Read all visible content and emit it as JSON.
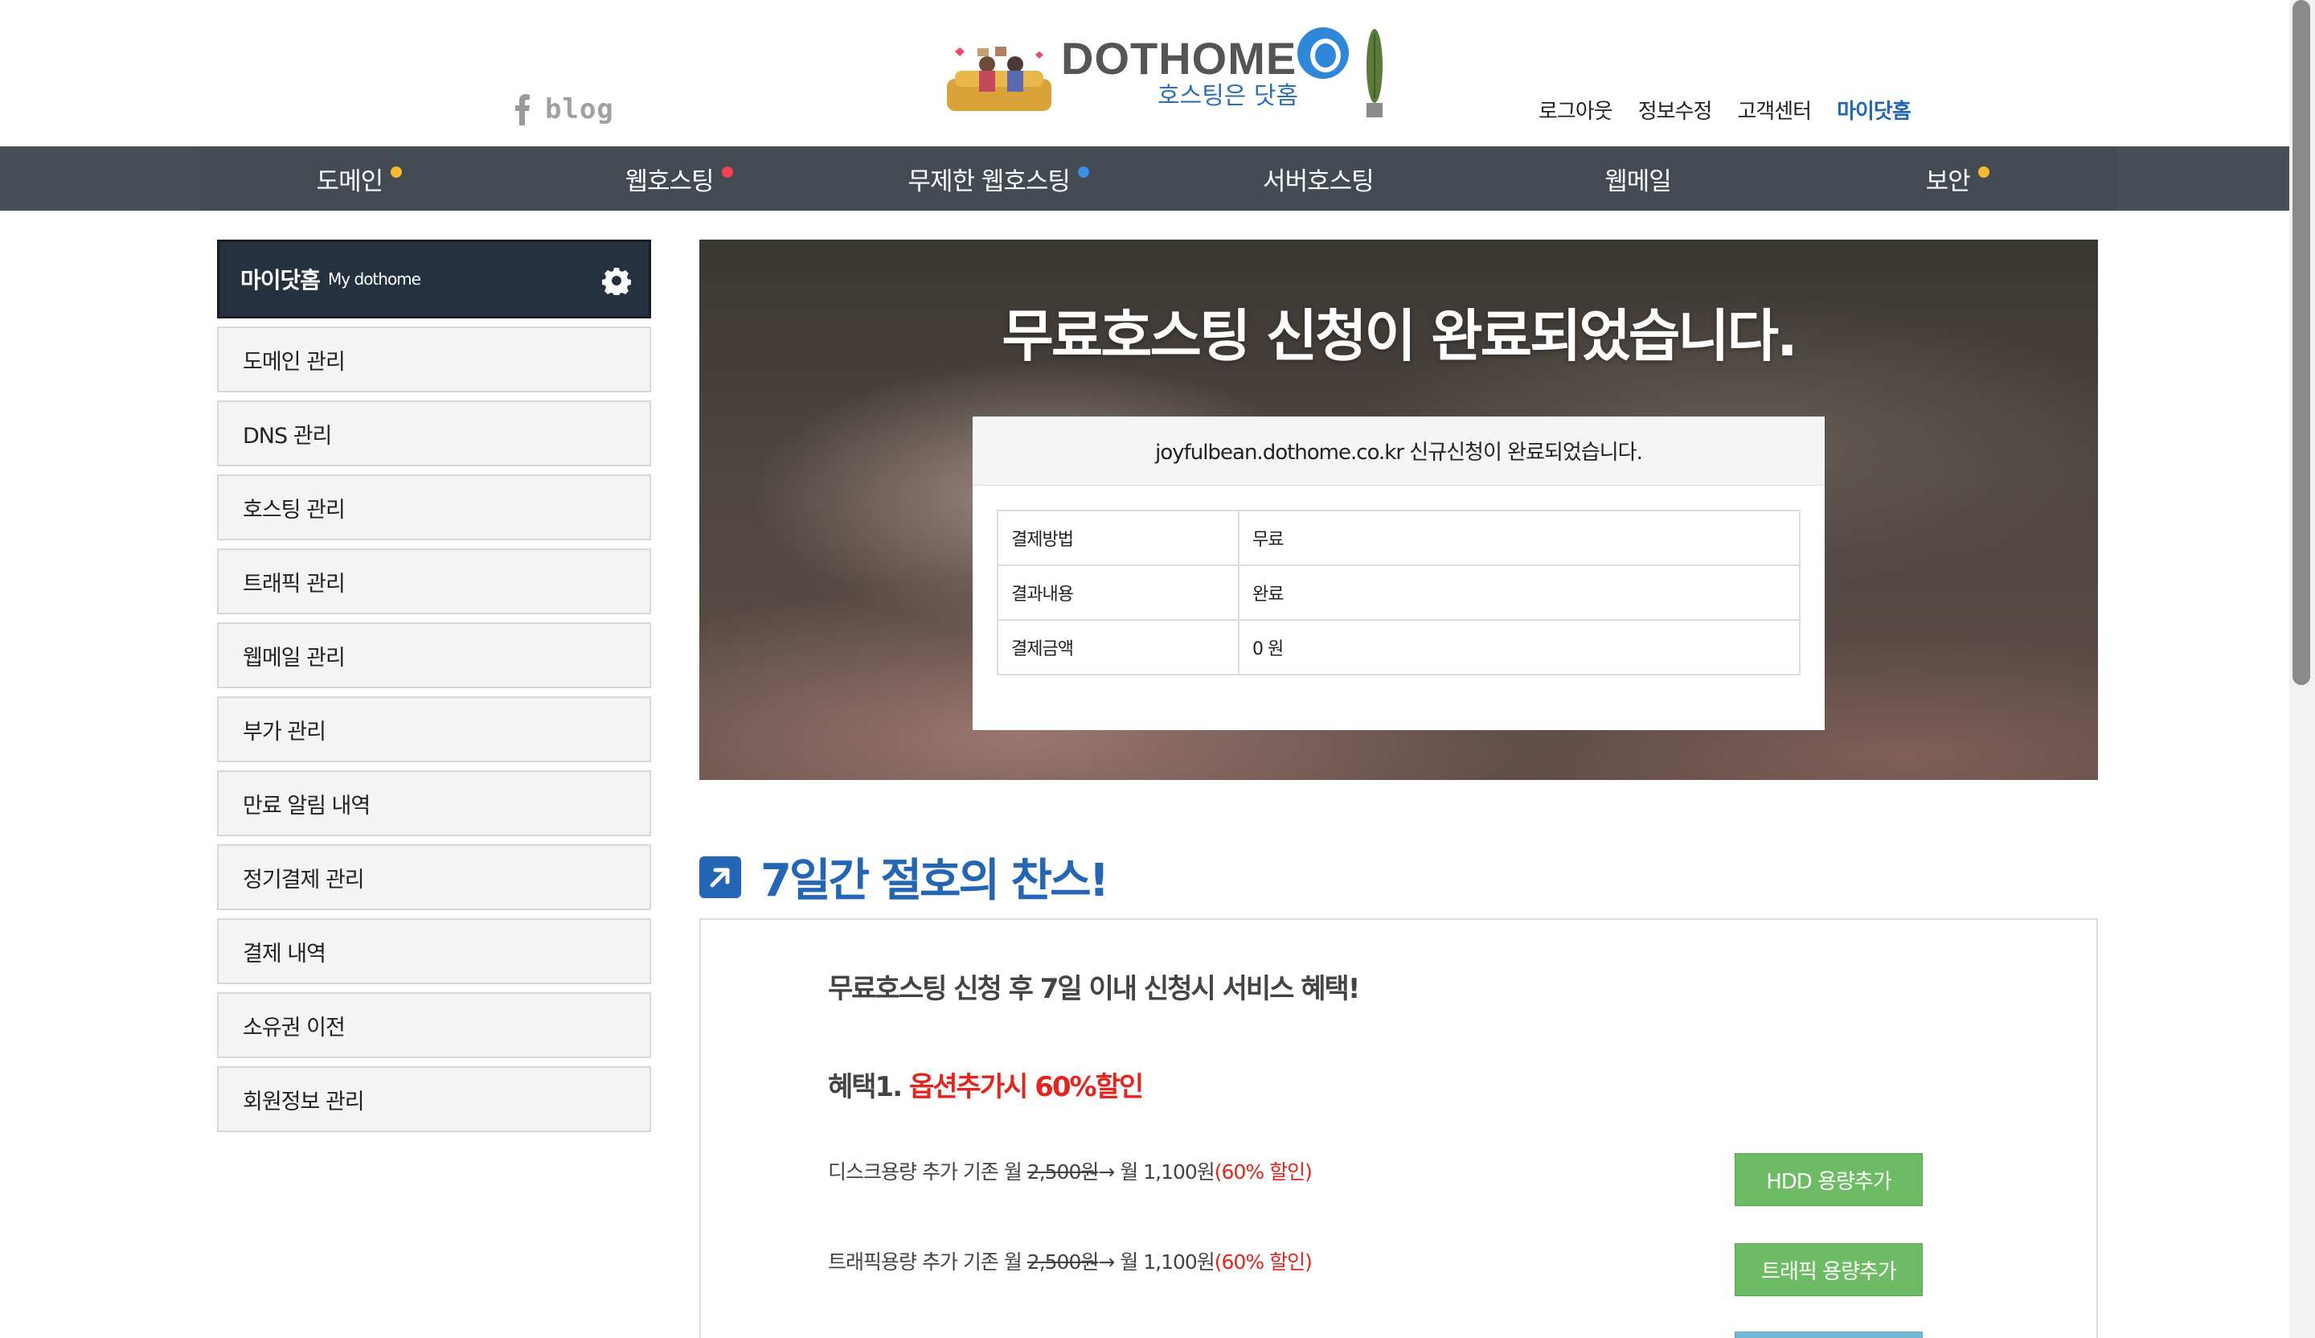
{
  "header": {
    "blog_label": "blog",
    "logo_title": "DOTHOME",
    "logo_subtitle": "호스팅은 닷홈",
    "user_menu": [
      {
        "label": "로그아웃"
      },
      {
        "label": "정보수정"
      },
      {
        "label": "고객센터"
      },
      {
        "label": "마이닷홈"
      }
    ]
  },
  "nav": {
    "items": [
      {
        "label": "도메인",
        "dot_color": "#f5b82e"
      },
      {
        "label": "웹호스팅",
        "dot_color": "#f0434f"
      },
      {
        "label": "무제한 웹호스팅",
        "dot_color": "#3a8fe8"
      },
      {
        "label": "서버호스팅",
        "dot_color": ""
      },
      {
        "label": "웹메일",
        "dot_color": ""
      },
      {
        "label": "보안",
        "dot_color": "#f5b82e"
      }
    ]
  },
  "sidebar": {
    "title": "마이닷홈",
    "title_en": "My dothome",
    "items": [
      {
        "label": "도메인 관리"
      },
      {
        "label": "DNS 관리"
      },
      {
        "label": "호스팅 관리"
      },
      {
        "label": "트래픽 관리"
      },
      {
        "label": "웹메일 관리"
      },
      {
        "label": "부가 관리"
      },
      {
        "label": "만료 알림 내역"
      },
      {
        "label": "정기결제 관리"
      },
      {
        "label": "결제 내역"
      },
      {
        "label": "소유권 이전"
      },
      {
        "label": "회원정보 관리"
      }
    ]
  },
  "hero": {
    "title": "무료호스팅 신청이 완료되었습니다.",
    "result_head": "joyfulbean.dothome.co.kr 신규신청이 완료되었습니다.",
    "rows": [
      {
        "key": "결제방법",
        "value": "무료"
      },
      {
        "key": "결과내용",
        "value": "완료"
      },
      {
        "key": "결제금액",
        "value": "0 원"
      }
    ]
  },
  "promo": {
    "section_title": "7일간 절호의 찬스!",
    "lead": "무료호스팅 신청 후 7일 이내 신청시 서비스 혜택!",
    "benefit_prefix": "혜택1.",
    "benefit_red": "옵션추가시 60%할인",
    "offers": [
      {
        "prefix": "디스크용량 추가 기존 월 ",
        "old_price": "2,500원",
        "arrow_text": "→ 월 1,100원",
        "discount": "(60% 할인)",
        "button": "HDD 용량추가"
      },
      {
        "prefix": "트래픽용량 추가 기존 월 ",
        "old_price": "2,500원",
        "arrow_text": "→ 월 1,100원",
        "discount": "(60% 할인)",
        "button": "트래픽 용량추가"
      }
    ]
  },
  "colors": {
    "accent_blue": "#2465b4",
    "nav_bg": "#434a52",
    "sidebar_head_bg": "#263140",
    "discount_red": "#e0261f",
    "button_green": "#6dbb64"
  }
}
